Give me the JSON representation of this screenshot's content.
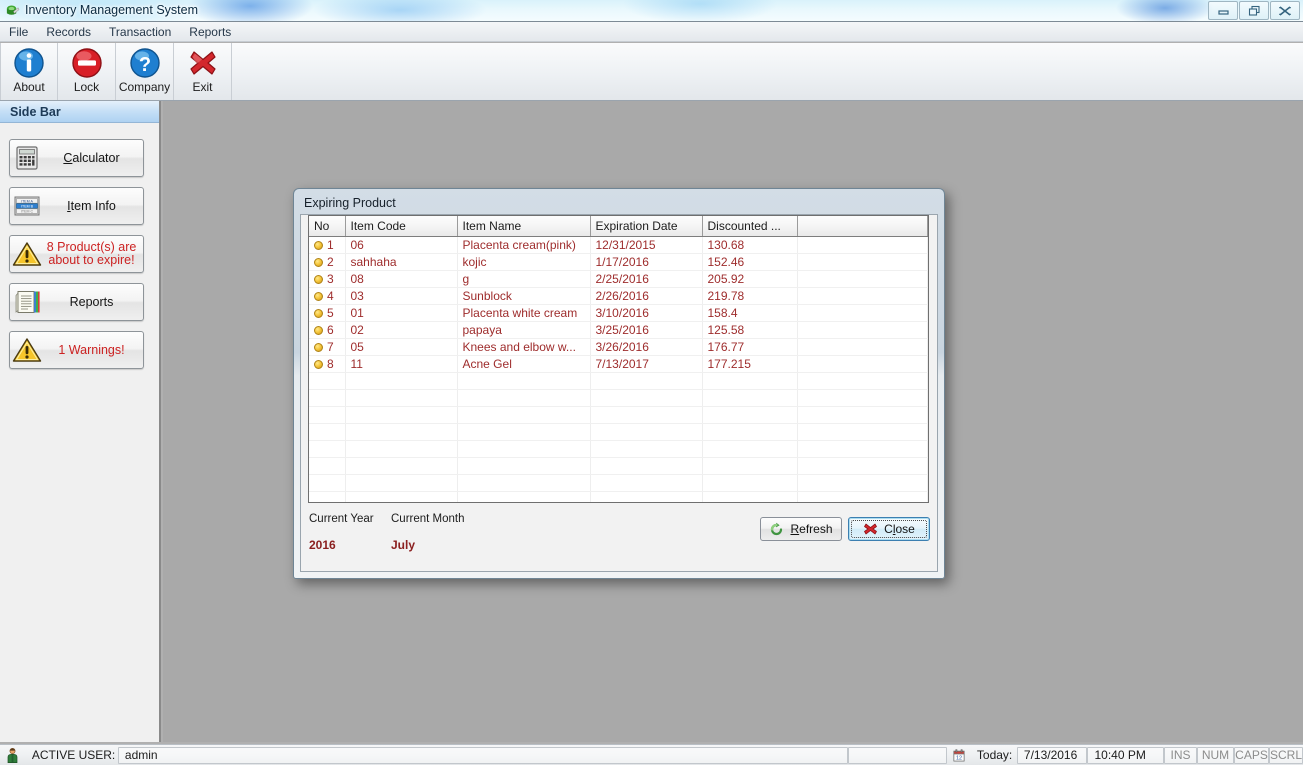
{
  "window": {
    "title": "Inventory Management System",
    "icon": "app-icon",
    "buttons": [
      {
        "name": "minimize",
        "glyph": "minimize-icon"
      },
      {
        "name": "restore",
        "glyph": "restore-icon"
      },
      {
        "name": "close",
        "glyph": "close-icon"
      }
    ]
  },
  "menubar": {
    "items": [
      {
        "label": "File"
      },
      {
        "label": "Records"
      },
      {
        "label": "Transaction"
      },
      {
        "label": "Reports"
      }
    ]
  },
  "toolbar": {
    "buttons": [
      {
        "label": "About",
        "icon": "info-icon"
      },
      {
        "label": "Lock",
        "icon": "lock-no-entry-icon"
      },
      {
        "label": "Company",
        "icon": "question-help-icon"
      },
      {
        "label": "Exit",
        "icon": "red-x-exit-icon"
      }
    ]
  },
  "sidebar": {
    "header": "Side Bar",
    "items": [
      {
        "label": "Calculator",
        "accel": "C",
        "icon": "calculator-icon",
        "warning": false
      },
      {
        "label": "Item Info",
        "accel": "I",
        "icon": "item-info-icon",
        "warning": false
      },
      {
        "label": "8 Product(s) are about to expire!",
        "line1": "8 Product(s) are",
        "line2": "about to expire!",
        "icon": "warning-triangle-icon",
        "warning": true
      },
      {
        "label": "Reports",
        "icon": "reports-icon",
        "warning": false
      },
      {
        "label": "1 Warnings!",
        "icon": "warning-triangle-icon",
        "warning": true
      }
    ]
  },
  "dialog": {
    "title": "Expiring Product",
    "grid": {
      "columns": [
        "No",
        "Item Code",
        "Item Name",
        "Expiration Date",
        "Discounted ...",
        ""
      ],
      "rows": [
        {
          "no": "1",
          "code": "06",
          "name": "Placenta cream(pink)",
          "expiry": "12/31/2015",
          "discounted": "130.68"
        },
        {
          "no": "2",
          "code": "sahhaha",
          "name": "kojic",
          "expiry": "1/17/2016",
          "discounted": "152.46"
        },
        {
          "no": "3",
          "code": "08",
          "name": "g",
          "expiry": "2/25/2016",
          "discounted": "205.92"
        },
        {
          "no": "4",
          "code": "03",
          "name": "Sunblock",
          "expiry": "2/26/2016",
          "discounted": "219.78"
        },
        {
          "no": "5",
          "code": "01",
          "name": "Placenta white cream",
          "expiry": "3/10/2016",
          "discounted": "158.4"
        },
        {
          "no": "6",
          "code": "02",
          "name": "papaya",
          "expiry": "3/25/2016",
          "discounted": "125.58"
        },
        {
          "no": "7",
          "code": "05",
          "name": "Knees and elbow w...",
          "expiry": "3/26/2016",
          "discounted": "176.77"
        },
        {
          "no": "8",
          "code": "11",
          "name": "Acne Gel",
          "expiry": "7/13/2017",
          "discounted": "177.215"
        }
      ],
      "empty_row_count": 8
    },
    "footer": {
      "current_year_label": "Current Year",
      "current_month_label": "Current Month",
      "current_year_value": "2016",
      "current_month_value": "July",
      "refresh_label": "Refresh",
      "refresh_accel": "R",
      "close_label": "Close",
      "close_accel": "l",
      "refresh_icon": "refresh-icon",
      "close_icon": "red-x-close-icon",
      "focused_button": "Close"
    }
  },
  "statusbar": {
    "user_icon": "user-icon",
    "active_user_label": "ACTIVE USER:",
    "active_user_value": "admin",
    "calendar_icon": "calendar-icon",
    "today_label": "Today:",
    "today_date": "7/13/2016",
    "time": "10:40 PM",
    "indicators": [
      "INS",
      "NUM",
      "CAPS",
      "SCRL"
    ]
  },
  "colors": {
    "warning_red": "#cc2222",
    "grid_text_red": "#9e2c2c",
    "accent_blue": "#2d7ac4",
    "desktop_gray": "#a9a9a9"
  }
}
